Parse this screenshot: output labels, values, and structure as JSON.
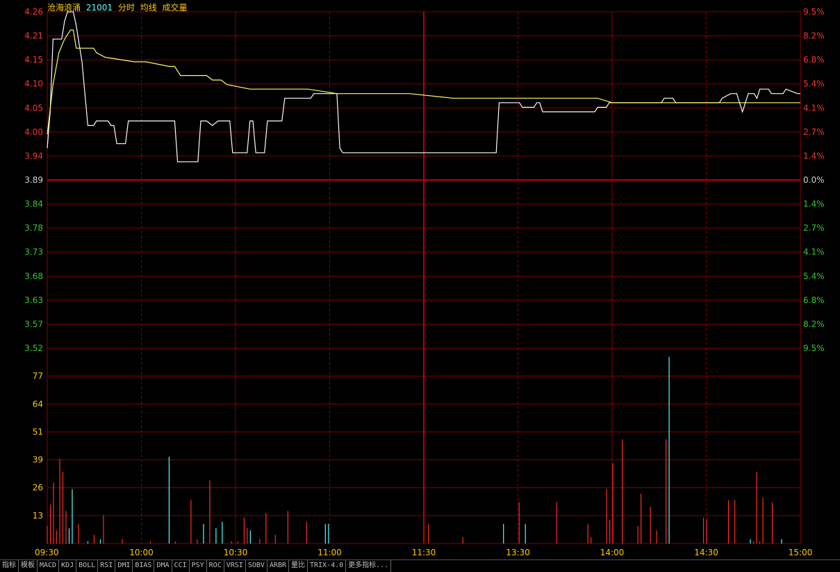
{
  "header": {
    "stock_name": "沧海浪涌",
    "code": "21001",
    "mode": "分时",
    "avg_label": "均线",
    "vol_label": "成交量"
  },
  "colors": {
    "price_line": "#ffffff",
    "avg_line": "#ffff66",
    "grid": "#8b0000",
    "up_text": "#ff3333",
    "down_text": "#33cc33",
    "neutral_text": "#d0d0d0",
    "vol_text": "#ffcc00",
    "vol_bar_red": "#ff2d2d",
    "vol_bar_cyan": "#54ffff",
    "time_text": "#ffcc00"
  },
  "tabs": [
    "指标",
    "模板",
    "MACD",
    "KDJ",
    "BOLL",
    "RSI",
    "DMI",
    "BIAS",
    "DMA",
    "CCI",
    "PSY",
    "ROC",
    "VRSI",
    "SOBV",
    "ARBR",
    "量比",
    "TRIX-4.0",
    "更多指标..."
  ],
  "chart_data": [
    {
      "type": "line",
      "title": "分时",
      "prev_close": 3.89,
      "price_ticks": [
        "4.26",
        "4.21",
        "4.15",
        "4.10",
        "4.05",
        "4.00",
        "3.94",
        "3.89",
        "3.84",
        "3.78",
        "3.73",
        "3.68",
        "3.63",
        "3.57",
        "3.52"
      ],
      "pct_ticks": [
        "9.5%",
        "8.2%",
        "6.8%",
        "5.4%",
        "4.1%",
        "2.7%",
        "1.4%",
        "0.0%",
        "1.4%",
        "2.7%",
        "4.1%",
        "5.4%",
        "6.8%",
        "8.2%",
        "9.5%"
      ],
      "ylim": [
        3.52,
        4.26
      ],
      "x_ticks": [
        "09:30",
        "10:00",
        "10:30",
        "11:00",
        "11:30",
        "13:30",
        "14:00",
        "14:30",
        "15:00"
      ],
      "series": [
        {
          "name": "分时",
          "points": [
            [
              0,
              3.96
            ],
            [
              1,
              4.04
            ],
            [
              2,
              4.2
            ],
            [
              5,
              4.2
            ],
            [
              6,
              4.24
            ],
            [
              7,
              4.26
            ],
            [
              9,
              4.26
            ],
            [
              10,
              4.23
            ],
            [
              12,
              4.15
            ],
            [
              14,
              4.01
            ],
            [
              16,
              4.01
            ],
            [
              17,
              4.02
            ],
            [
              21,
              4.02
            ],
            [
              22,
              4.01
            ],
            [
              23,
              4.01
            ],
            [
              24,
              3.97
            ],
            [
              27,
              3.97
            ],
            [
              28,
              4.02
            ],
            [
              43,
              4.02
            ],
            [
              44,
              4.02
            ],
            [
              45,
              3.93
            ],
            [
              52,
              3.93
            ],
            [
              53,
              4.02
            ],
            [
              55,
              4.02
            ],
            [
              57,
              4.01
            ],
            [
              59,
              4.02
            ],
            [
              63,
              4.02
            ],
            [
              64,
              3.95
            ],
            [
              69,
              3.95
            ],
            [
              70,
              4.02
            ],
            [
              71,
              4.02
            ],
            [
              72,
              3.95
            ],
            [
              75,
              3.95
            ],
            [
              76,
              4.02
            ],
            [
              81,
              4.02
            ],
            [
              82,
              4.07
            ],
            [
              91,
              4.07
            ],
            [
              92,
              4.08
            ],
            [
              100,
              4.08
            ],
            [
              101,
              3.96
            ],
            [
              102,
              3.95
            ],
            [
              155,
              3.95
            ],
            [
              156,
              4.06
            ],
            [
              163,
              4.06
            ],
            [
              164,
              4.05
            ],
            [
              168,
              4.05
            ],
            [
              169,
              4.06
            ],
            [
              170,
              4.06
            ],
            [
              171,
              4.04
            ],
            [
              189,
              4.04
            ],
            [
              190,
              4.05
            ],
            [
              193,
              4.05
            ],
            [
              194,
              4.06
            ],
            [
              199,
              4.06
            ],
            [
              200,
              4.06
            ],
            [
              212,
              4.06
            ],
            [
              213,
              4.07
            ],
            [
              216,
              4.07
            ],
            [
              217,
              4.06
            ],
            [
              218,
              4.06
            ],
            [
              226,
              4.06
            ],
            [
              227,
              4.06
            ],
            [
              232,
              4.06
            ],
            [
              233,
              4.07
            ],
            [
              236,
              4.08
            ],
            [
              238,
              4.08
            ],
            [
              239,
              4.06
            ],
            [
              240,
              4.04
            ],
            [
              241,
              4.06
            ],
            [
              242,
              4.08
            ],
            [
              244,
              4.08
            ],
            [
              245,
              4.07
            ],
            [
              246,
              4.09
            ],
            [
              249,
              4.09
            ],
            [
              250,
              4.08
            ],
            [
              254,
              4.08
            ],
            [
              255,
              4.09
            ],
            [
              259,
              4.08
            ],
            [
              260,
              4.08
            ]
          ]
        },
        {
          "name": "均线",
          "points": [
            [
              0,
              3.99
            ],
            [
              2,
              4.1
            ],
            [
              4,
              4.17
            ],
            [
              6,
              4.2
            ],
            [
              8,
              4.22
            ],
            [
              9,
              4.22
            ],
            [
              10,
              4.18
            ],
            [
              12,
              4.18
            ],
            [
              16,
              4.18
            ],
            [
              17,
              4.17
            ],
            [
              20,
              4.16
            ],
            [
              30,
              4.15
            ],
            [
              34,
              4.15
            ],
            [
              42,
              4.14
            ],
            [
              44,
              4.14
            ],
            [
              46,
              4.12
            ],
            [
              55,
              4.12
            ],
            [
              57,
              4.11
            ],
            [
              60,
              4.11
            ],
            [
              62,
              4.1
            ],
            [
              70,
              4.09
            ],
            [
              76,
              4.09
            ],
            [
              82,
              4.09
            ],
            [
              90,
              4.09
            ],
            [
              100,
              4.08
            ],
            [
              120,
              4.08
            ],
            [
              125,
              4.08
            ],
            [
              140,
              4.07
            ],
            [
              160,
              4.07
            ],
            [
              170,
              4.07
            ],
            [
              180,
              4.07
            ],
            [
              190,
              4.07
            ],
            [
              195,
              4.06
            ],
            [
              200,
              4.06
            ],
            [
              210,
              4.06
            ],
            [
              215,
              4.06
            ],
            [
              220,
              4.06
            ],
            [
              230,
              4.06
            ],
            [
              240,
              4.06
            ],
            [
              250,
              4.06
            ],
            [
              260,
              4.06
            ]
          ]
        }
      ]
    },
    {
      "type": "bar",
      "title": "成交量",
      "y_ticks": [
        "77",
        "64",
        "51",
        "39",
        "26",
        "13"
      ],
      "ylim": [
        0,
        90
      ],
      "x_max": 241,
      "bars": [
        {
          "x": 0,
          "v": 8,
          "c": "r"
        },
        {
          "x": 1,
          "v": 18,
          "c": "r"
        },
        {
          "x": 2,
          "v": 28,
          "c": "r"
        },
        {
          "x": 3,
          "v": 6,
          "c": "r"
        },
        {
          "x": 4,
          "v": 39,
          "c": "r"
        },
        {
          "x": 5,
          "v": 33,
          "c": "r"
        },
        {
          "x": 6,
          "v": 15,
          "c": "r"
        },
        {
          "x": 7,
          "v": 7,
          "c": "c"
        },
        {
          "x": 8,
          "v": 25,
          "c": "c"
        },
        {
          "x": 10,
          "v": 9,
          "c": "r"
        },
        {
          "x": 13,
          "v": 1,
          "c": "c"
        },
        {
          "x": 15,
          "v": 4,
          "c": "r"
        },
        {
          "x": 17,
          "v": 2,
          "c": "c"
        },
        {
          "x": 18,
          "v": 13,
          "c": "r"
        },
        {
          "x": 24,
          "v": 2,
          "c": "r"
        },
        {
          "x": 33,
          "v": 1,
          "c": "r"
        },
        {
          "x": 39,
          "v": 40,
          "c": "c"
        },
        {
          "x": 41,
          "v": 1,
          "c": "r"
        },
        {
          "x": 46,
          "v": 20,
          "c": "r"
        },
        {
          "x": 48,
          "v": 2,
          "c": "r"
        },
        {
          "x": 50,
          "v": 9,
          "c": "c"
        },
        {
          "x": 52,
          "v": 29,
          "c": "r"
        },
        {
          "x": 54,
          "v": 7,
          "c": "c"
        },
        {
          "x": 56,
          "v": 10,
          "c": "c"
        },
        {
          "x": 59,
          "v": 1,
          "c": "r"
        },
        {
          "x": 61,
          "v": 1,
          "c": "r"
        },
        {
          "x": 63,
          "v": 12,
          "c": "r"
        },
        {
          "x": 64,
          "v": 7,
          "c": "r"
        },
        {
          "x": 65,
          "v": 6,
          "c": "c"
        },
        {
          "x": 68,
          "v": 2,
          "c": "r"
        },
        {
          "x": 70,
          "v": 14,
          "c": "r"
        },
        {
          "x": 73,
          "v": 4,
          "c": "r"
        },
        {
          "x": 77,
          "v": 15,
          "c": "r"
        },
        {
          "x": 83,
          "v": 10,
          "c": "r"
        },
        {
          "x": 89,
          "v": 9,
          "c": "c"
        },
        {
          "x": 90,
          "v": 9,
          "c": "c"
        },
        {
          "x": 122,
          "v": 9,
          "c": "r"
        },
        {
          "x": 133,
          "v": 3,
          "c": "r"
        },
        {
          "x": 146,
          "v": 9,
          "c": "c"
        },
        {
          "x": 151,
          "v": 19,
          "c": "r"
        },
        {
          "x": 153,
          "v": 9,
          "c": "c"
        },
        {
          "x": 163,
          "v": 19,
          "c": "r"
        },
        {
          "x": 173,
          "v": 9,
          "c": "r"
        },
        {
          "x": 174,
          "v": 3,
          "c": "r"
        },
        {
          "x": 179,
          "v": 25,
          "c": "r"
        },
        {
          "x": 180,
          "v": 11,
          "c": "r"
        },
        {
          "x": 181,
          "v": 37,
          "c": "r"
        },
        {
          "x": 184,
          "v": 48,
          "c": "r"
        },
        {
          "x": 189,
          "v": 8,
          "c": "r"
        },
        {
          "x": 190,
          "v": 23,
          "c": "r"
        },
        {
          "x": 193,
          "v": 17,
          "c": "r"
        },
        {
          "x": 195,
          "v": 6,
          "c": "r"
        },
        {
          "x": 198,
          "v": 48,
          "c": "r"
        },
        {
          "x": 199,
          "v": 86,
          "c": "c"
        },
        {
          "x": 210,
          "v": 12,
          "c": "r"
        },
        {
          "x": 211,
          "v": 11,
          "c": "r"
        },
        {
          "x": 218,
          "v": 20,
          "c": "r"
        },
        {
          "x": 220,
          "v": 20,
          "c": "r"
        },
        {
          "x": 225,
          "v": 2,
          "c": "c"
        },
        {
          "x": 226,
          "v": 1,
          "c": "r"
        },
        {
          "x": 227,
          "v": 33,
          "c": "r"
        },
        {
          "x": 228,
          "v": 1,
          "c": "r"
        },
        {
          "x": 229,
          "v": 21,
          "c": "r"
        },
        {
          "x": 232,
          "v": 19,
          "c": "r"
        },
        {
          "x": 235,
          "v": 2,
          "c": "c"
        }
      ]
    }
  ]
}
